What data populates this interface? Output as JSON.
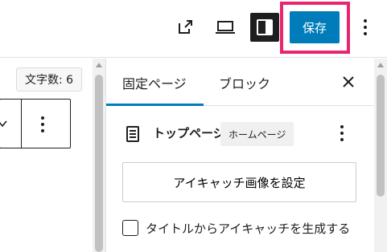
{
  "toolbar": {
    "save_label": "保存",
    "icons": {
      "view_external": "external-link-icon",
      "preview": "desktop-icon",
      "settings": "sidebar-toggle-icon",
      "options": "more-vertical-icon"
    }
  },
  "editor": {
    "word_count": "文字数: 6",
    "block_toolbar_icons": [
      "chevron-down-icon",
      "more-vertical-icon"
    ]
  },
  "sidebar": {
    "tabs": [
      {
        "label": "固定ページ",
        "active": true
      },
      {
        "label": "ブロック",
        "active": false
      }
    ],
    "page": {
      "title": "トップページ",
      "badge": "ホームページ"
    },
    "featured_image_button": "アイキャッチ画像を設定",
    "generate_checkbox": {
      "label": "タイトルからアイキャッチを生成する",
      "checked": false
    }
  },
  "colors": {
    "accent": "#007cba",
    "highlight": "#e8266f",
    "dark": "#1e1e1e"
  }
}
